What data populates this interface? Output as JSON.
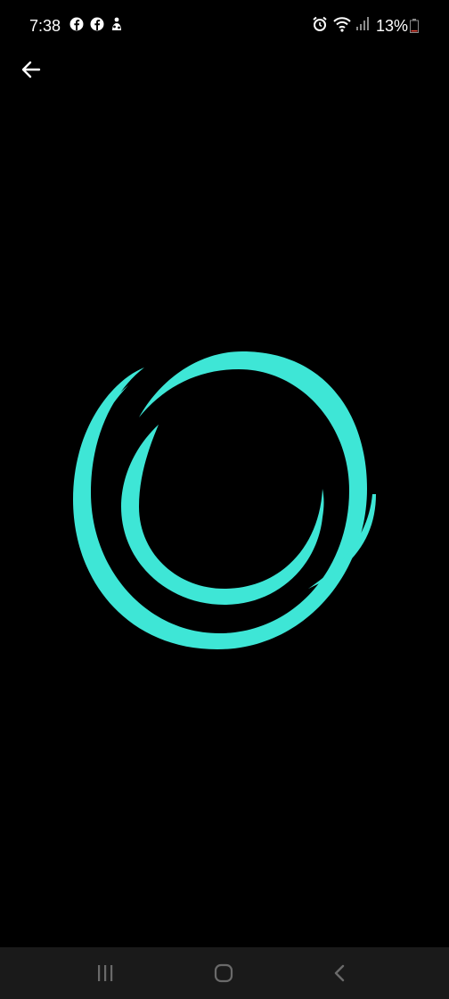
{
  "status_bar": {
    "time": "7:38",
    "battery_percent": "13%",
    "left_icons": [
      "facebook-icon",
      "facebook-icon",
      "notification-icon"
    ],
    "right_icons": [
      "alarm-icon",
      "wifi-icon",
      "signal-icon"
    ],
    "battery_level": 0.13
  },
  "header": {
    "back_icon": "arrow-left-icon"
  },
  "logo": {
    "icon": "swirl-circle-logo",
    "color": "#3ee6d6"
  },
  "nav_bar": {
    "items": [
      "recent-apps",
      "home",
      "back"
    ],
    "background": "#1a1a1a"
  },
  "colors": {
    "background": "#000000",
    "accent": "#3ee6d6",
    "battery_low": "#e0463a"
  }
}
